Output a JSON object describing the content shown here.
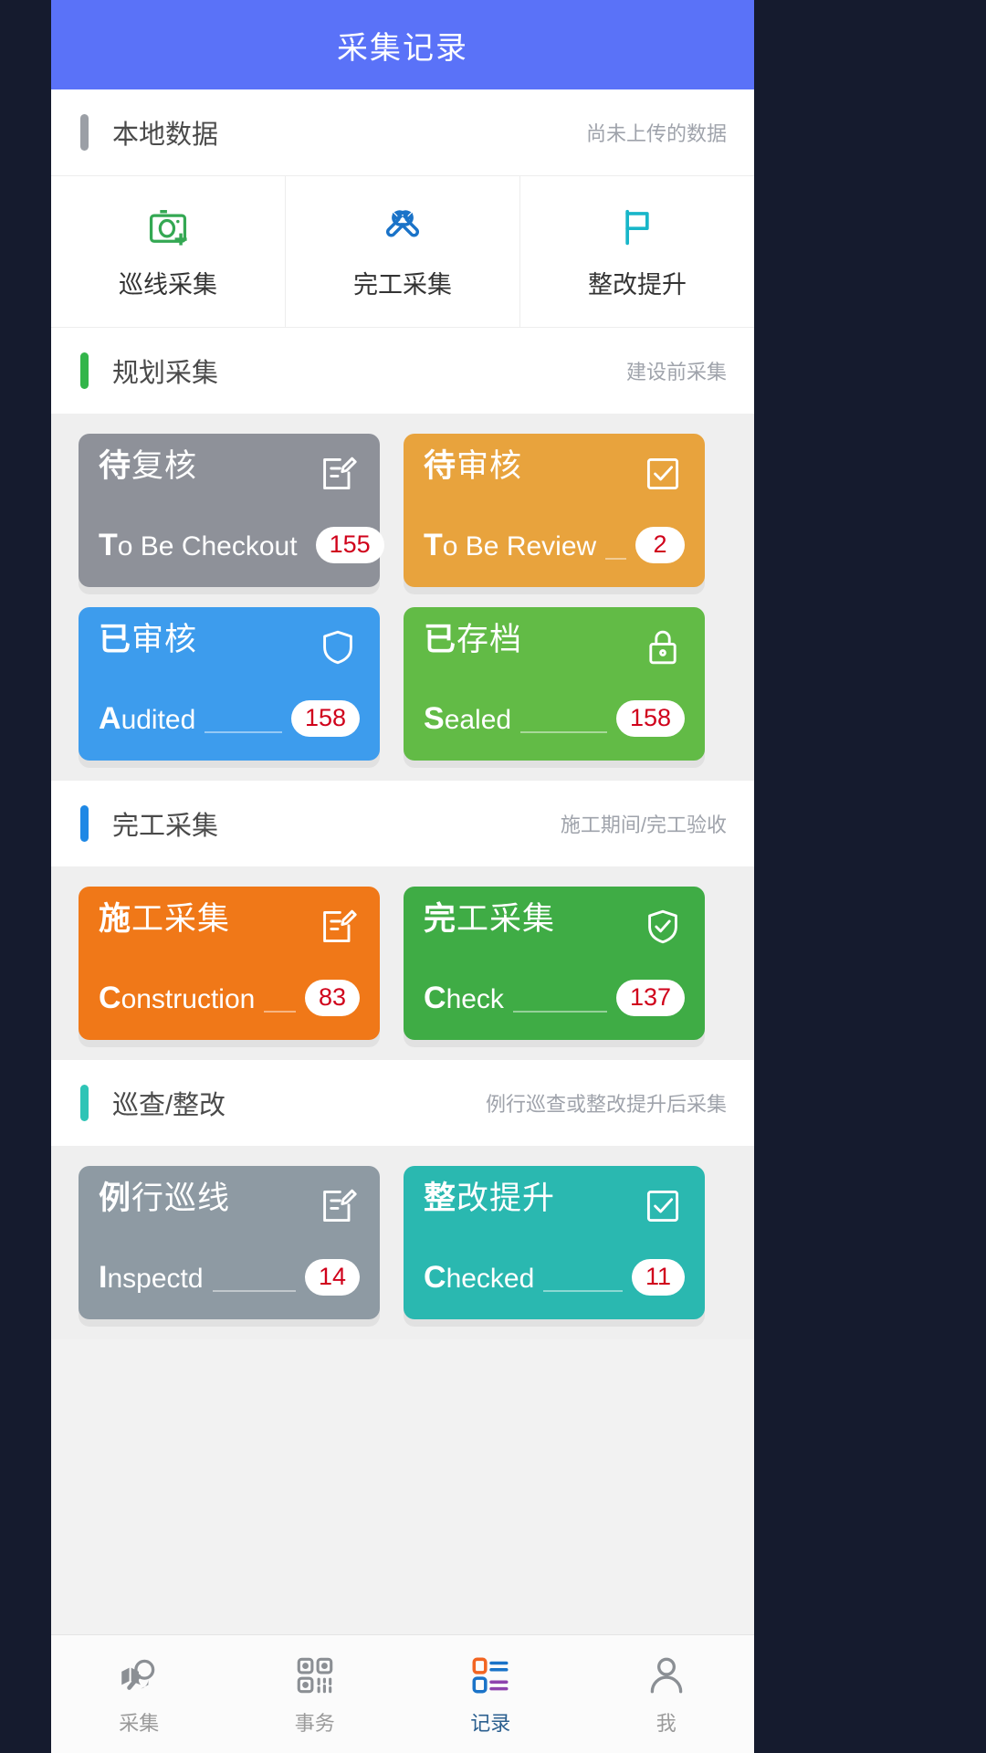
{
  "header": {
    "title": "采集记录"
  },
  "sections": [
    {
      "id": "local-data",
      "title": "本地数据",
      "note": "尚未上传的数据",
      "accent": "#9b9fa6"
    },
    {
      "id": "planning",
      "title": "规划采集",
      "note": "建设前采集",
      "accent": "#33b54a"
    },
    {
      "id": "completion",
      "title": "完工采集",
      "note": "施工期间/完工验收",
      "accent": "#1e88e5"
    },
    {
      "id": "inspection",
      "title": "巡查/整改",
      "note": "例行巡查或整改提升后采集",
      "accent": "#2ec4b6"
    }
  ],
  "quick_actions": [
    {
      "label": "巡线采集",
      "icon": "camera-add-icon",
      "color": "#34a853"
    },
    {
      "label": "完工采集",
      "icon": "tools-icon",
      "color": "#1a73c8"
    },
    {
      "label": "整改提升",
      "icon": "flag-icon",
      "color": "#18b6c9"
    }
  ],
  "planning_cards": [
    {
      "cn_lead": "待",
      "cn_rest": "复核",
      "en_lead": "T",
      "en_rest": "o Be Checkout",
      "count": "155",
      "color": "#8e9199",
      "icon": "edit-document-icon"
    },
    {
      "cn_lead": "待",
      "cn_rest": "审核",
      "en_lead": "T",
      "en_rest": "o Be Review",
      "count": "2",
      "color": "#e8a33d",
      "icon": "checkbox-icon"
    },
    {
      "cn_lead": "已",
      "cn_rest": "审核",
      "en_lead": "A",
      "en_rest": "udited",
      "count": "158",
      "color": "#3d9ced",
      "icon": "shield-icon"
    },
    {
      "cn_lead": "已",
      "cn_rest": "存档",
      "en_lead": "S",
      "en_rest": "ealed",
      "count": "158",
      "color": "#62bb46",
      "icon": "lock-icon"
    }
  ],
  "completion_cards": [
    {
      "cn_lead": "施",
      "cn_rest": "工采集",
      "en_lead": "C",
      "en_rest": "onstruction",
      "count": "83",
      "color": "#f07818",
      "icon": "edit-document-icon"
    },
    {
      "cn_lead": "完",
      "cn_rest": "工采集",
      "en_lead": "C",
      "en_rest": "heck",
      "count": "137",
      "color": "#3fac45",
      "icon": "shield-check-icon"
    }
  ],
  "inspection_cards": [
    {
      "cn_lead": "例",
      "cn_rest": "行巡线",
      "en_lead": "I",
      "en_rest": "nspectd",
      "count": "14",
      "color": "#8e9aa3",
      "icon": "edit-document-icon"
    },
    {
      "cn_lead": "整",
      "cn_rest": "改提升",
      "en_lead": "C",
      "en_rest": "hecked",
      "count": "11",
      "color": "#2ab8b0",
      "icon": "checkbox-icon"
    }
  ],
  "bottom_nav": [
    {
      "label": "采集",
      "icon": "map-search-icon",
      "active": false
    },
    {
      "label": "事务",
      "icon": "qrcode-icon",
      "active": false
    },
    {
      "label": "记录",
      "icon": "record-list-icon",
      "active": true
    },
    {
      "label": "我",
      "icon": "person-icon",
      "active": false
    }
  ]
}
